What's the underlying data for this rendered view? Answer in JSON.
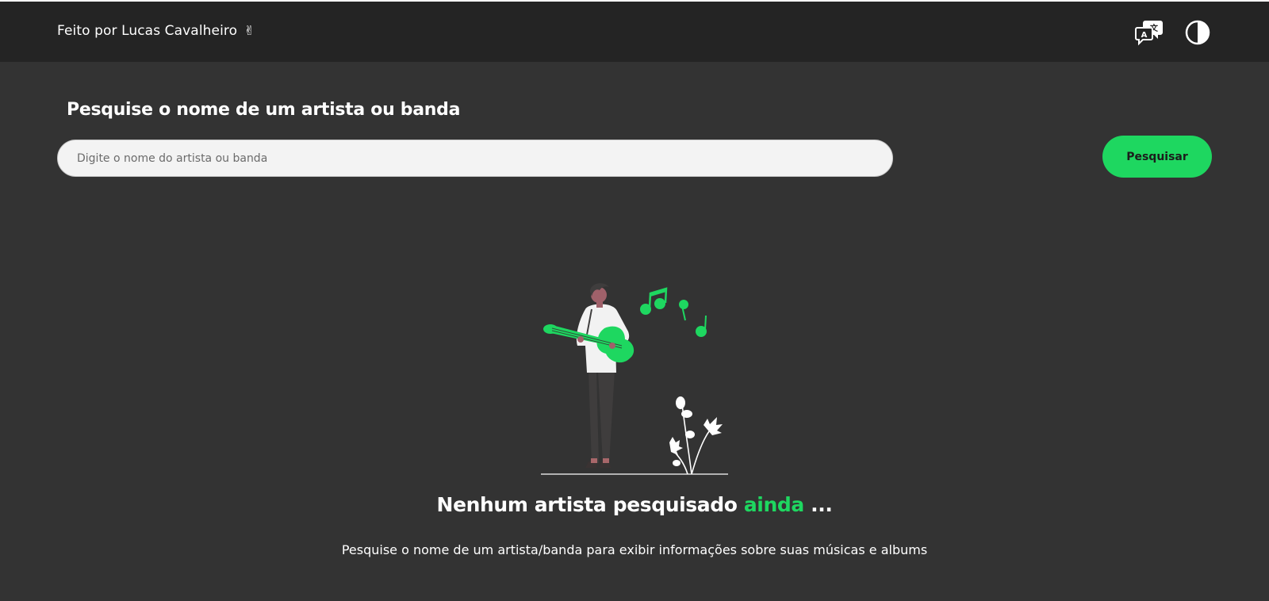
{
  "header": {
    "credit": "Feito por Lucas Cavalheiro",
    "credit_emoji": "✌",
    "icons": {
      "translate": "translate-icon",
      "theme": "contrast-icon"
    }
  },
  "search": {
    "title": "Pesquise o nome de um artista ou banda",
    "placeholder": "Digite o nome do artista ou banda",
    "value": "",
    "button_label": "Pesquisar"
  },
  "empty_state": {
    "title_main": "Nenhum artista pesquisado",
    "title_accent": "ainda",
    "title_suffix": "...",
    "description": "Pesquise o nome de um artista/banda para exibir informações sobre suas músicas e albums",
    "illustration": "guitarist-illustration"
  },
  "colors": {
    "background": "#333333",
    "header": "#242424",
    "accent": "#1ed760",
    "input_bg": "#f3f3f3"
  }
}
